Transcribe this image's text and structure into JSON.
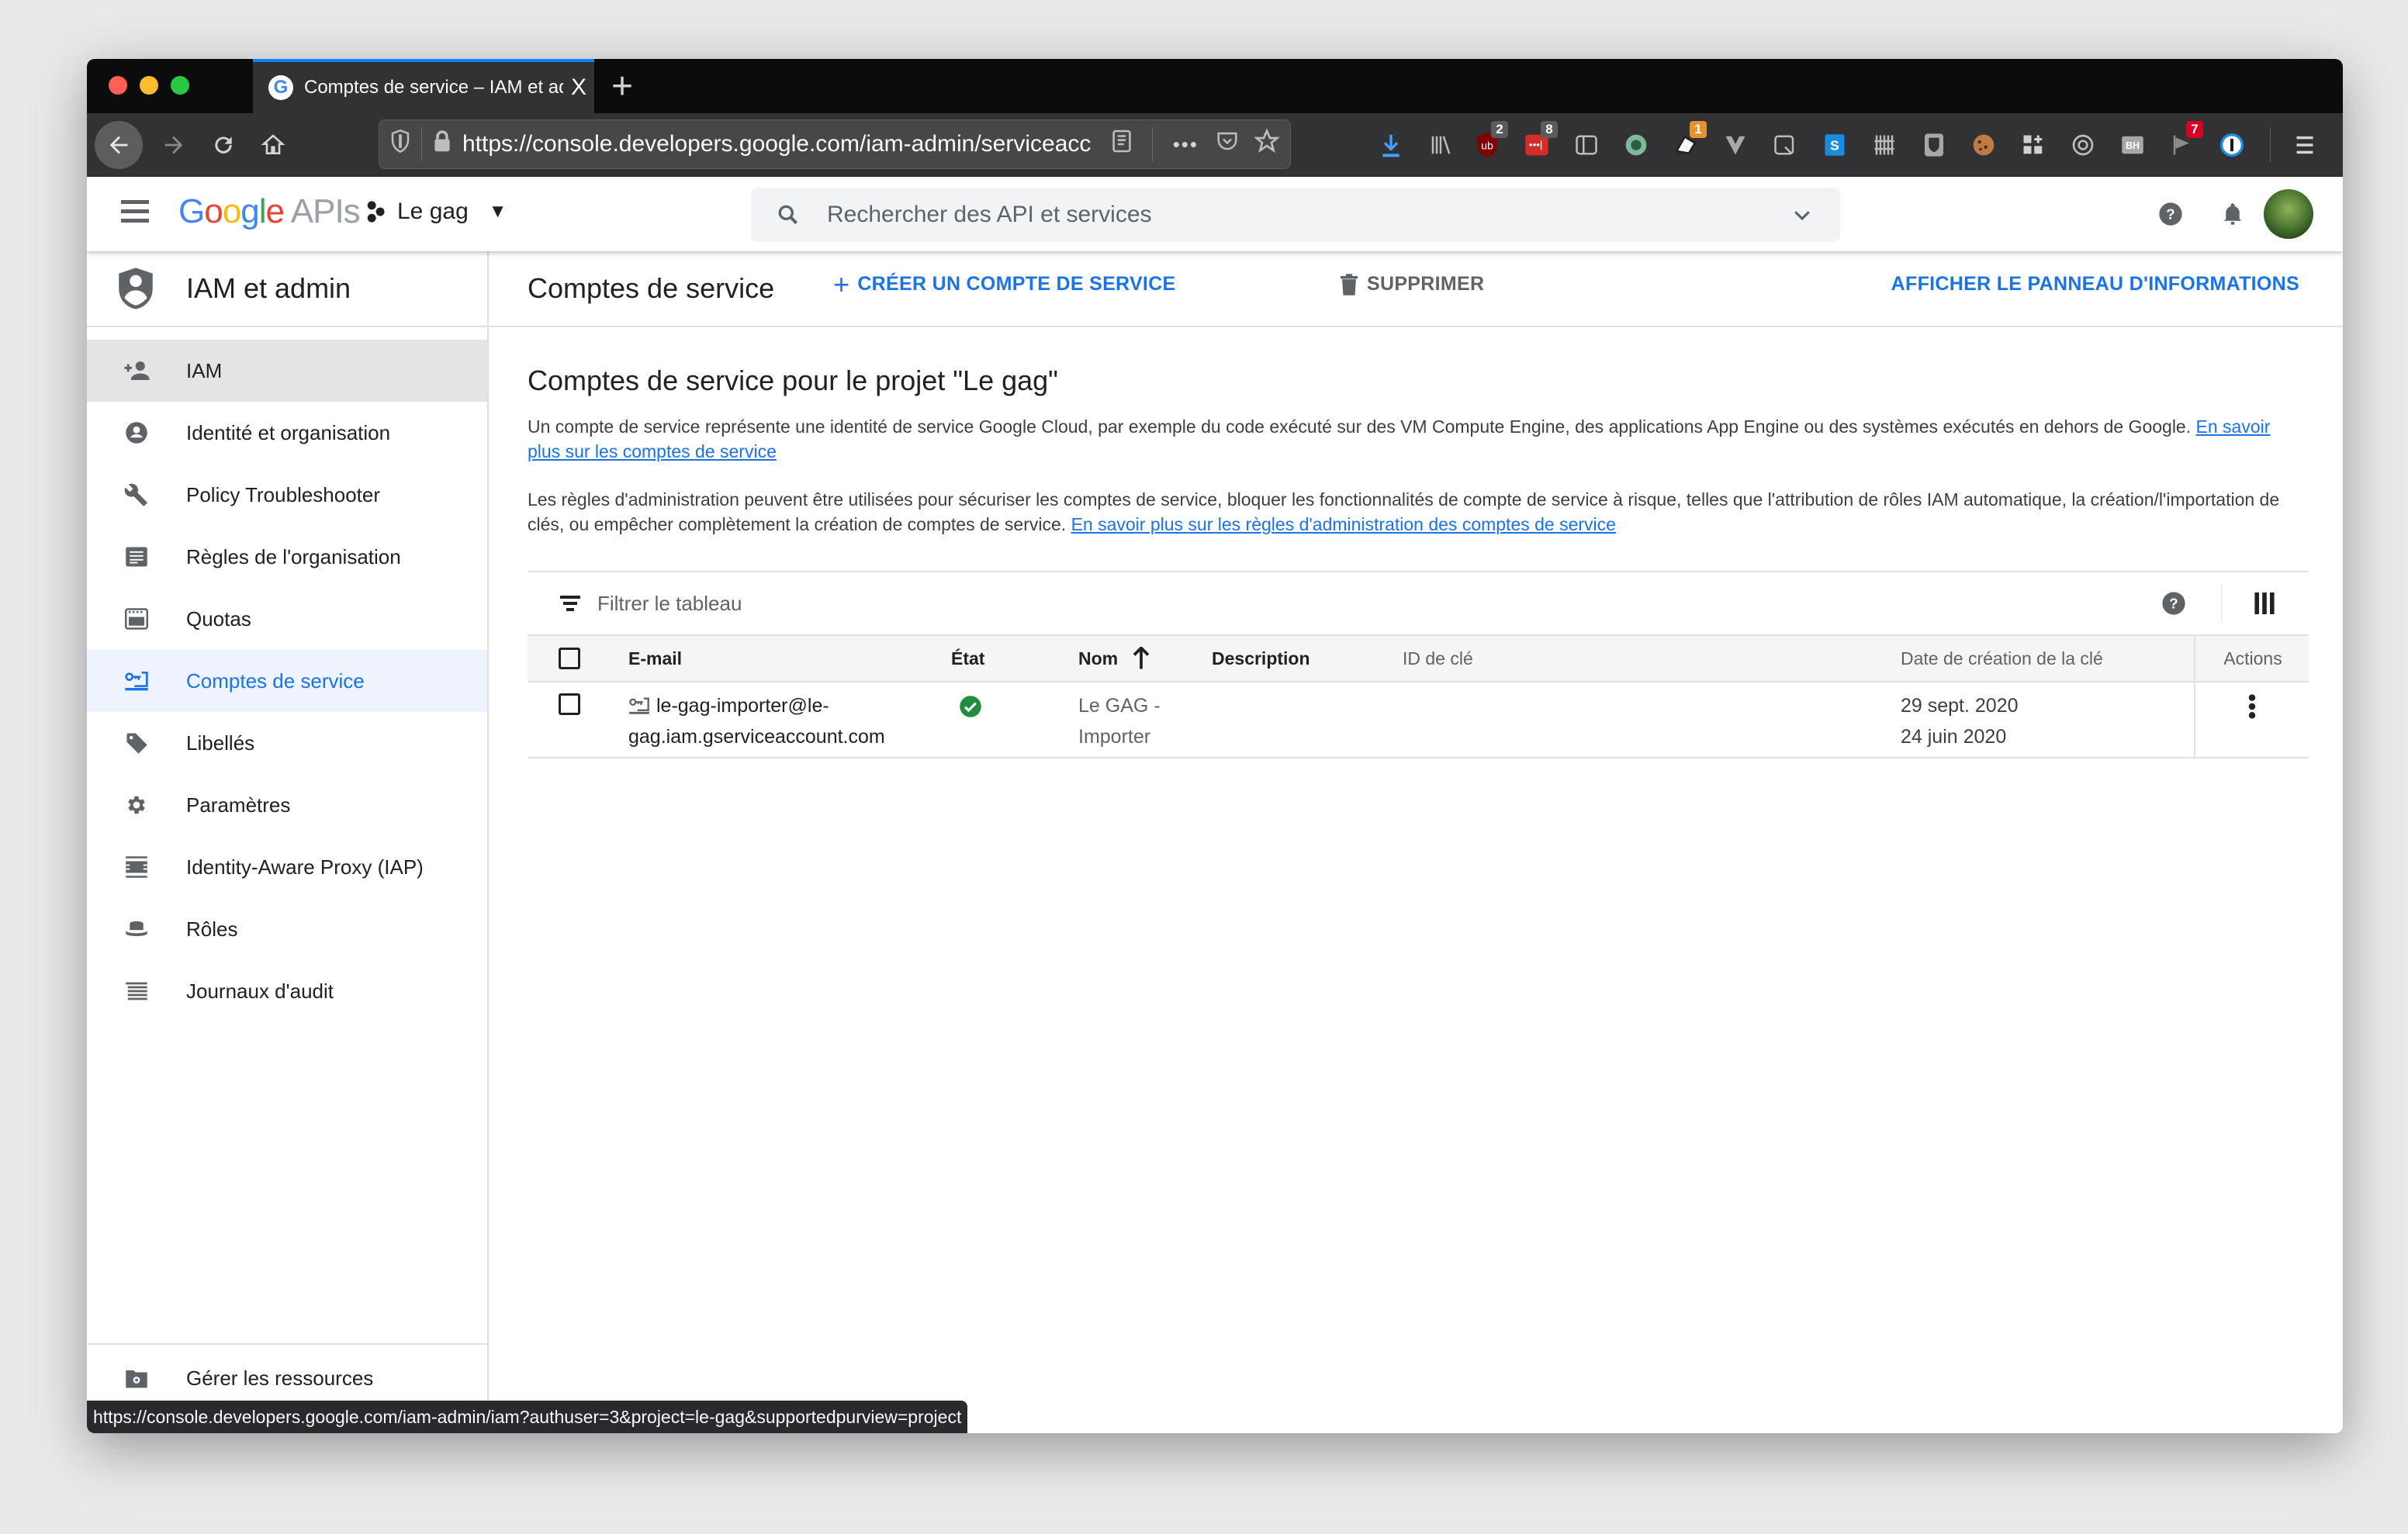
{
  "browser": {
    "tab_title": "Comptes de service – IAM et admin",
    "tab_close": "X",
    "new_tab": "+",
    "url": "https://console.developers.google.com/iam-admin/serviceaccounts",
    "url_display": "https://console.developers.google.com/iam-admin/serviceacc",
    "extension_badges": {
      "ublock": "2",
      "lastpass": "8",
      "privacy_badger": "1",
      "flag": "7"
    },
    "status_url": "https://console.developers.google.com/iam-admin/iam?authuser=3&project=le-gag&supportedpurview=project"
  },
  "header": {
    "logo_google": "Google",
    "logo_apis": "APIs",
    "project": "Le gag",
    "search_placeholder": "Rechercher des API et services"
  },
  "sidebar": {
    "title": "IAM et admin",
    "items": [
      {
        "label": "IAM",
        "icon": "person-add-icon",
        "state": "hover"
      },
      {
        "label": "Identité et organisation",
        "icon": "account-circle-icon"
      },
      {
        "label": "Policy Troubleshooter",
        "icon": "wrench-icon"
      },
      {
        "label": "Règles de l'organisation",
        "icon": "document-list-icon"
      },
      {
        "label": "Quotas",
        "icon": "quota-icon"
      },
      {
        "label": "Comptes de service",
        "icon": "service-account-key-icon",
        "state": "active"
      },
      {
        "label": "Libellés",
        "icon": "tag-icon"
      },
      {
        "label": "Paramètres",
        "icon": "gear-icon"
      },
      {
        "label": "Identity-Aware Proxy (IAP)",
        "icon": "iap-icon"
      },
      {
        "label": "Rôles",
        "icon": "hat-icon"
      },
      {
        "label": "Journaux d'audit",
        "icon": "list-lines-icon"
      }
    ],
    "manage_resources": "Gérer les ressources",
    "collapse": "<|"
  },
  "toolbar": {
    "page_title": "Comptes de service",
    "create_label": "CRÉER UN COMPTE DE SERVICE",
    "delete_label": "SUPPRIMER",
    "info_panel_label": "AFFICHER LE PANNEAU D'INFORMATIONS"
  },
  "content": {
    "heading": "Comptes de service pour le projet \"Le gag\"",
    "desc1": "Un compte de service représente une identité de service Google Cloud, par exemple du code exécuté sur des VM Compute Engine, des applications App Engine ou des systèmes exécutés en dehors de Google. ",
    "desc1_link": "En savoir plus sur les comptes de service",
    "desc2": "Les règles d'administration peuvent être utilisées pour sécuriser les comptes de service, bloquer les fonctionnalités de compte de service à risque, telles que l'attribution de rôles IAM automatique, la création/l'importation de clés, ou empêcher complètement la création de comptes de service. ",
    "desc2_link": "En savoir plus sur les règles d'administration des comptes de service"
  },
  "table": {
    "filter_placeholder": "Filtrer le tableau",
    "columns": {
      "email": "E-mail",
      "state": "État",
      "name": "Nom",
      "description": "Description",
      "key_id": "ID de clé",
      "key_date": "Date de création de la clé",
      "actions": "Actions"
    },
    "sort": {
      "column": "name",
      "direction": "ascending"
    },
    "rows": [
      {
        "email_line1": "le-gag-importer@le-",
        "email_line2": "gag.iam.gserviceaccount.com",
        "state": "enabled",
        "name_line1": "Le GAG -",
        "name_line2": "Importer",
        "description": "",
        "key_id": "",
        "key_date_1": "29 sept. 2020",
        "key_date_2": "24 juin 2020"
      }
    ]
  },
  "colors": {
    "accent": "#1a73e8",
    "success": "#1e8e3e",
    "tab_highlight": "#0a84ff"
  }
}
